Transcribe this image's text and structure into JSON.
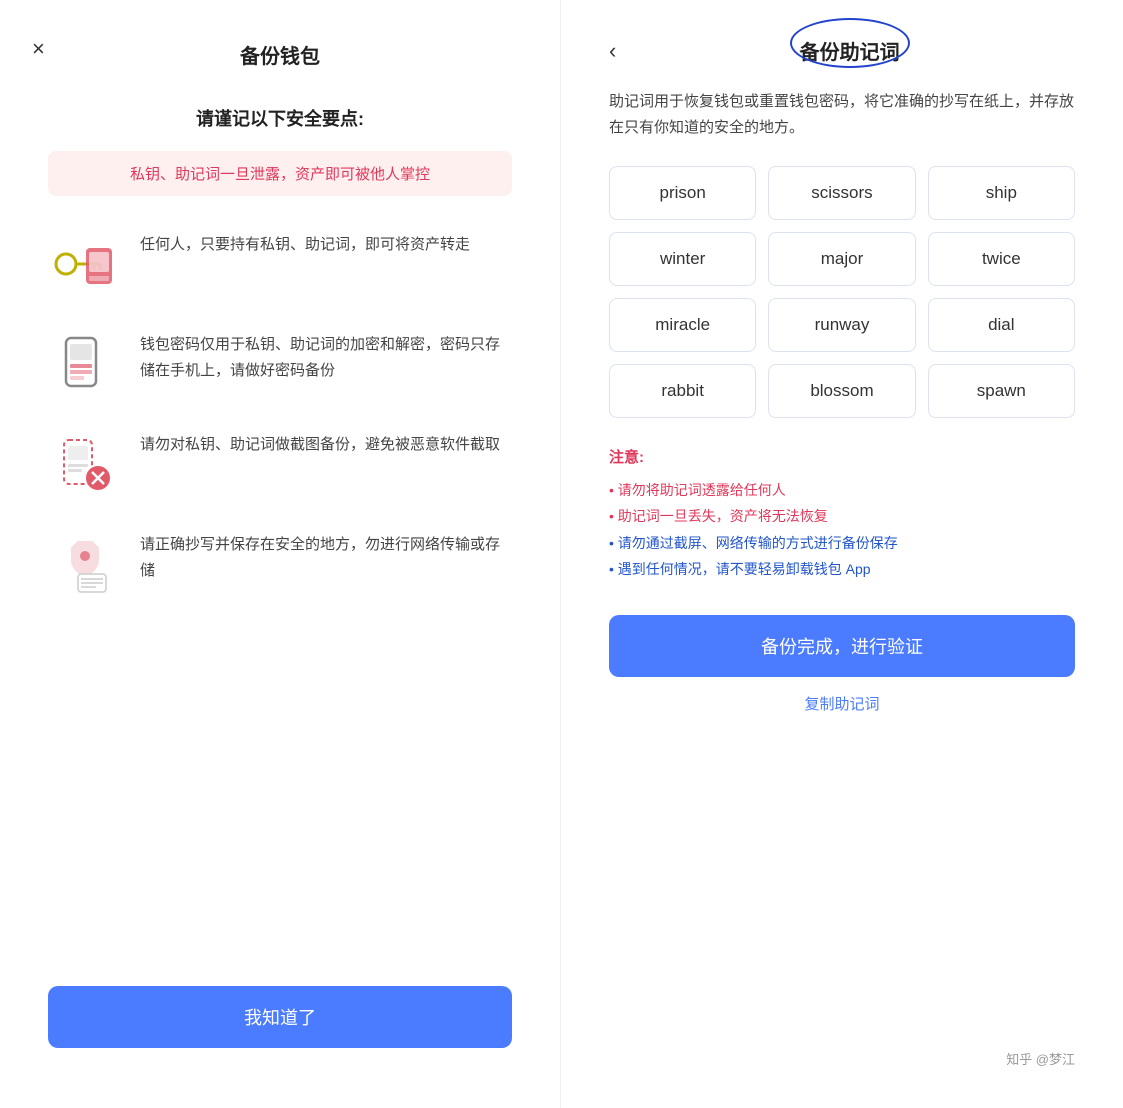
{
  "left": {
    "close_icon": "×",
    "title": "备份钱包",
    "subtitle": "请谨记以下安全要点:",
    "warning_text": "私钥、助记词一旦泄露，资产即可被他人掌控",
    "features": [
      {
        "text": "任何人，只要持有私钥、助记词，即可将资产转走"
      },
      {
        "text": "钱包密码仅用于私钥、助记词的加密和解密，密码只存储在手机上，请做好密码备份"
      },
      {
        "text": "请勿对私钥、助记词做截图备份，避免被恶意软件截取"
      },
      {
        "text": "请正确抄写并保存在安全的地方，勿进行网络传输或存储"
      }
    ],
    "button_label": "我知道了"
  },
  "right": {
    "back_icon": "‹",
    "title": "备份助记词",
    "description": "助记词用于恢复钱包或重置钱包密码，将它准确的抄写在纸上，并存放在只有你知道的安全的地方。",
    "mnemonic_words": [
      "prison",
      "scissors",
      "ship",
      "winter",
      "major",
      "twice",
      "miracle",
      "runway",
      "dial",
      "rabbit",
      "blossom",
      "spawn"
    ],
    "notes_title": "注意:",
    "notes": [
      {
        "text": "• 请勿将助记词透露给任何人",
        "type": "red"
      },
      {
        "text": "• 助记词一旦丢失，资产将无法恢复",
        "type": "red"
      },
      {
        "text": "• 请勿通过截屏、网络传输的方式进行备份保存",
        "type": "blue"
      },
      {
        "text": "• 遇到任何情况，请不要轻易卸载钱包 App",
        "type": "blue"
      }
    ],
    "verify_button_label": "备份完成，进行验证",
    "copy_link_label": "复制助记词"
  },
  "watermark": "知乎 @梦江"
}
